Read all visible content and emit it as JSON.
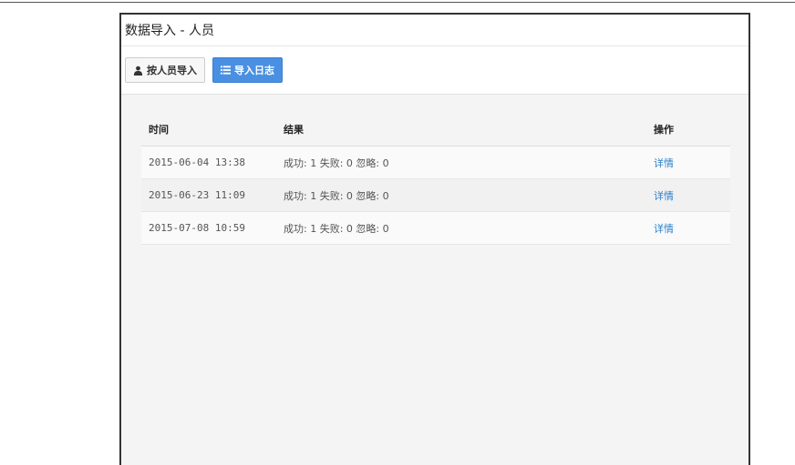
{
  "window": {
    "title": "数据导入 - 人员"
  },
  "toolbar": {
    "import_by_person_label": "按人员导入",
    "import_log_label": "导入日志",
    "import_by_person_icon": "user-icon",
    "import_log_icon": "list-icon"
  },
  "table": {
    "headers": {
      "time": "时间",
      "result": "结果",
      "action": "操作"
    },
    "rows": [
      {
        "time": "2015-06-04 13:38",
        "result": "成功: 1 失败: 0 忽略: 0",
        "action": "详情"
      },
      {
        "time": "2015-06-23 11:09",
        "result": "成功: 1 失败: 0 忽略: 0",
        "action": "详情"
      },
      {
        "time": "2015-07-08 10:59",
        "result": "成功: 1 失败: 0 忽略: 0",
        "action": "详情"
      }
    ]
  },
  "colors": {
    "primary": "#4a90e2",
    "link": "#2a7fc9",
    "content_bg": "#f4f4f4"
  }
}
